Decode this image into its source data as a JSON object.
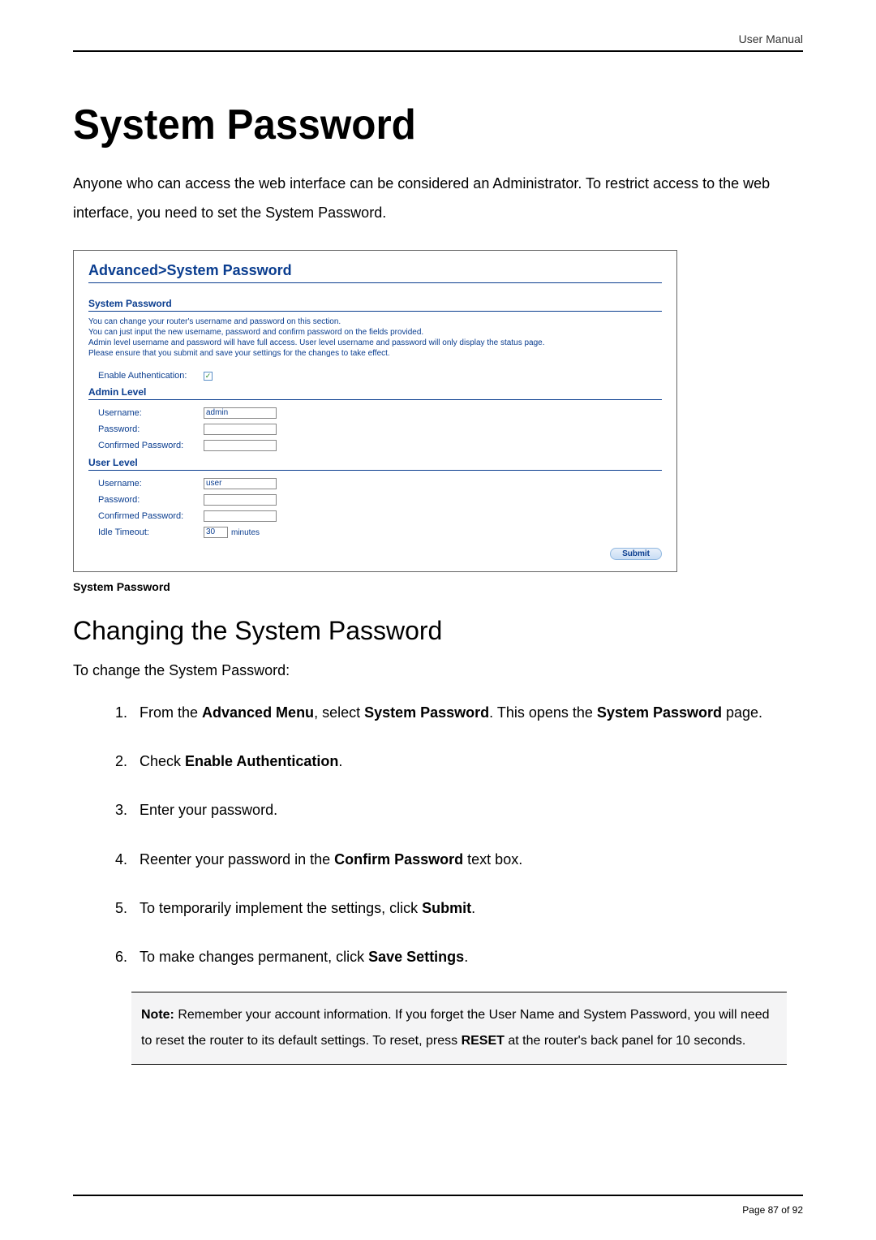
{
  "header": {
    "label": "User Manual"
  },
  "title": "System Password",
  "intro": "Anyone who can access the web interface can be considered an Administrator. To restrict access to the web interface, you need to set the System Password.",
  "panel": {
    "title": "Advanced>System Password",
    "section_head": "System Password",
    "desc_line1": "You can change your router's username and password on this section.",
    "desc_line2": "You can just input the new username, password and confirm password on the fields provided.",
    "desc_line3": "Admin level username and password will have full access. User level username and password will only display the status page.",
    "desc_line4": "Please ensure that you submit and save your settings for the changes to take effect.",
    "enable_auth_label": "Enable Authentication:",
    "admin_head": "Admin Level",
    "user_head": "User Level",
    "labels": {
      "username": "Username:",
      "password": "Password:",
      "confirmed": "Confirmed Password:",
      "idle": "Idle Timeout:"
    },
    "values": {
      "admin_username": "admin",
      "user_username": "user",
      "idle_timeout": "30",
      "idle_unit": "minutes"
    },
    "submit_label": "Submit"
  },
  "caption": "System Password",
  "subheading": "Changing the System Password",
  "lead": "To change the System Password:",
  "steps": {
    "s1a": "From the ",
    "s1b": "Advanced Menu",
    "s1c": ", select ",
    "s1d": "System Password",
    "s1e": ". This opens the ",
    "s1f": "System Password",
    "s1g": " page.",
    "s2a": "Check ",
    "s2b": "Enable Authentication",
    "s2c": ".",
    "s3": "Enter your password.",
    "s4a": "Reenter your password in the ",
    "s4b": "Confirm Password",
    "s4c": " text box.",
    "s5a": "To temporarily implement the settings, click ",
    "s5b": "Submit",
    "s5c": ".",
    "s6a": "To make changes permanent, click ",
    "s6b": "Save Settings",
    "s6c": "."
  },
  "note": {
    "lead": "Note:",
    "body1": " Remember your account information. If you forget the User Name and System Password, you will need to reset the router to its default settings. To reset, press ",
    "reset": "RESET",
    "body2": " at the router's back panel for 10 seconds."
  },
  "footer": {
    "page": "Page 87 of 92"
  }
}
